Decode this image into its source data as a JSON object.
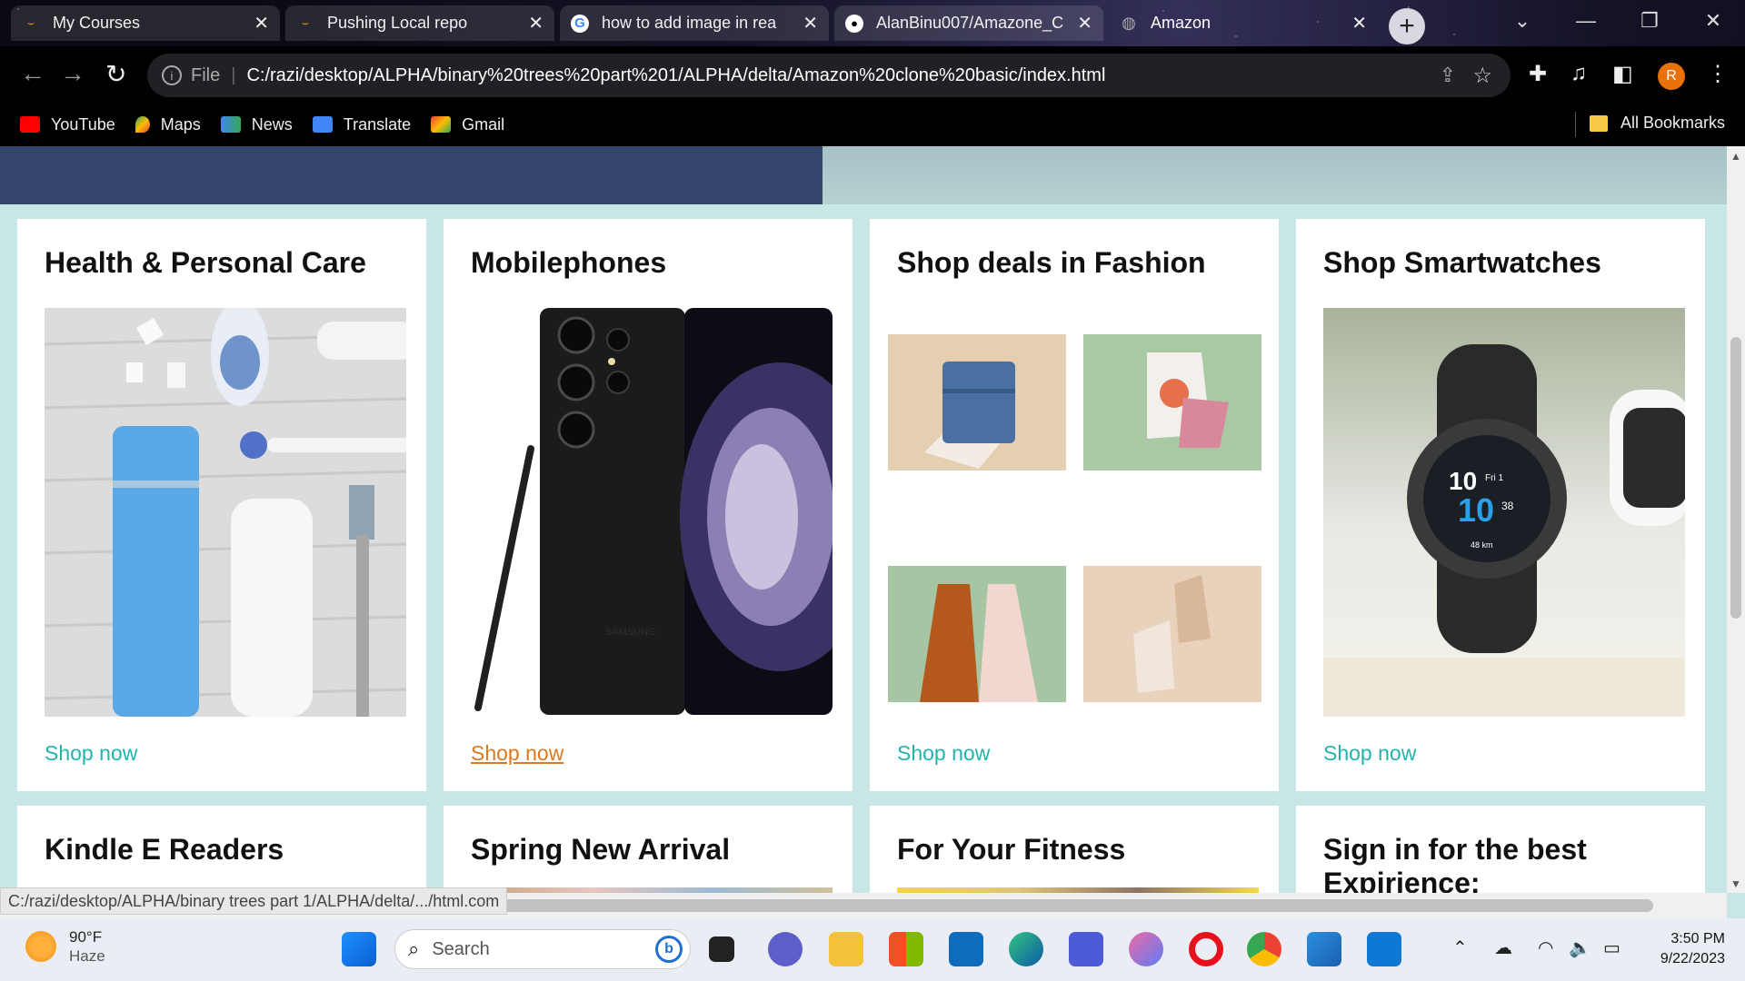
{
  "browser": {
    "tabs": [
      {
        "title": "My Courses",
        "active": false
      },
      {
        "title": "Pushing Local repo",
        "active": false
      },
      {
        "title": "how to add image in rea",
        "active": false
      },
      {
        "title": "AlanBinu007/Amazone_C",
        "active": false
      },
      {
        "title": "Amazon",
        "active": true
      }
    ],
    "new_tab": "+",
    "omnibox": {
      "scheme_label": "File",
      "url": "C:/razi/desktop/ALPHA/binary%20trees%20part%201/ALPHA/delta/Amazon%20clone%20basic/index.html"
    },
    "profile_initial": "R",
    "bookmarks": [
      "YouTube",
      "Maps",
      "News",
      "Translate",
      "Gmail"
    ],
    "all_bookmarks": "All Bookmarks"
  },
  "page": {
    "cards": [
      {
        "title": "Health & Personal Care",
        "link": "Shop now"
      },
      {
        "title": "Mobilephones",
        "link": "Shop now"
      },
      {
        "title": "Shop deals in Fashion",
        "link": "Shop now"
      },
      {
        "title": "Shop Smartwatches",
        "link": "Shop now"
      },
      {
        "title": "Kindle E Readers"
      },
      {
        "title": "Spring New Arrival"
      },
      {
        "title": "For Your Fitness"
      },
      {
        "title": "Sign in for the best Expirience:"
      }
    ],
    "phone_brand": "SAMSUNG",
    "watch": {
      "time_hour": "10",
      "day": "Fri 1",
      "time_min": "10",
      "seconds": "38",
      "distance": "48 km"
    }
  },
  "status_url": "C:/razi/desktop/ALPHA/binary trees part 1/ALPHA/delta/.../html.com",
  "taskbar": {
    "weather": {
      "temp": "90°F",
      "condition": "Haze"
    },
    "search_placeholder": "Search",
    "clock": {
      "time": "3:50 PM",
      "date": "9/22/2023"
    }
  },
  "colors": {
    "link": "#1fb5ad",
    "link_hover": "#d97a22",
    "nav_blue": "#34466e",
    "page_bg": "#c9e6e6"
  }
}
